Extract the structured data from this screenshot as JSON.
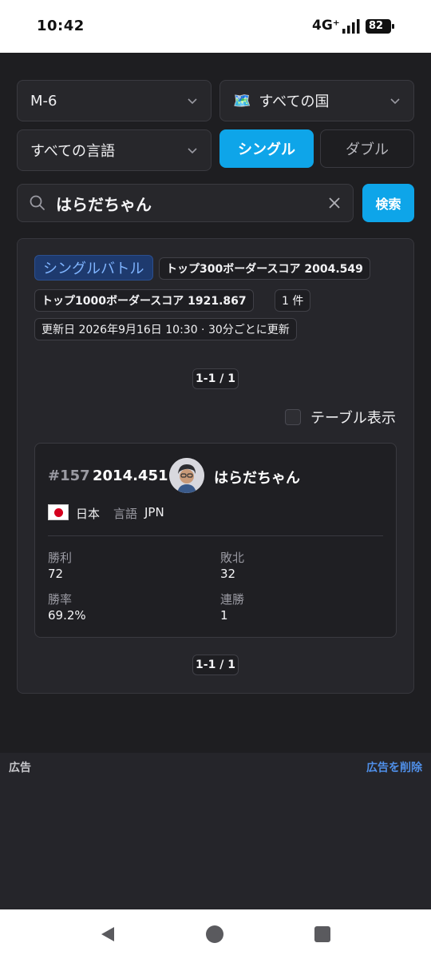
{
  "status_bar": {
    "time": "10:42",
    "network": "4G⁺",
    "battery": "82"
  },
  "filters": {
    "mode": "M-6",
    "country": "すべての国",
    "country_icon": "world-map-icon",
    "language": "すべての言語",
    "battle_type_single": "シングル",
    "battle_type_double": "ダブル",
    "battle_type_selected": "シングル"
  },
  "search": {
    "value": "はらだちゃん",
    "button": "検索"
  },
  "panel": {
    "battle_badge": "シングルバトル",
    "top300": "トップ300ボーダースコア 2004.549",
    "top1000": "トップ1000ボーダースコア 1921.867",
    "count": "1 件",
    "updated": "更新日 2026年9月16日 10:30 · 30分ごとに更新",
    "pager_top": "1-1 / 1",
    "pager_bottom": "1-1 / 1",
    "table_toggle_label": "テーブル表示",
    "table_toggle_checked": false
  },
  "player": {
    "rank": "#157",
    "score": "2014.451",
    "name": "はらだちゃん",
    "country": "日本",
    "language_label": "言語",
    "language": "JPN",
    "stats": {
      "wins_label": "勝利",
      "wins": "72",
      "losses_label": "敗北",
      "losses": "32",
      "winrate_label": "勝率",
      "winrate": "69.2%",
      "streak_label": "連勝",
      "streak": "1"
    }
  },
  "ad": {
    "label": "広告",
    "remove": "広告を削除"
  },
  "colors": {
    "accent": "#0ea5e9",
    "background": "#1e1e21",
    "badge_blue": "#1e3a6e"
  }
}
